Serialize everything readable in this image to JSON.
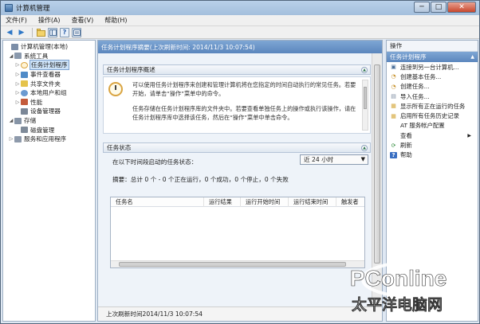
{
  "window": {
    "title": "计算机管理",
    "buttons": {
      "minimize": "─",
      "maximize": "□",
      "close": "✕"
    }
  },
  "menubar": {
    "items": [
      "文件(F)",
      "操作(A)",
      "查看(V)",
      "帮助(H)"
    ]
  },
  "toolbar": {
    "back": "◀",
    "forward": "▶"
  },
  "tree": {
    "items": [
      {
        "label": "计算机管理(本地)",
        "expander": "",
        "icon": "computer-management-icon",
        "color": "#7c8ea8"
      },
      {
        "label": "系统工具",
        "expander": "◢",
        "icon": "system-tools-icon",
        "color": "#8a99ad"
      },
      {
        "label": "任务计划程序",
        "expander": "▷",
        "icon": "clock-icon",
        "color": "#d9a441",
        "selected": true
      },
      {
        "label": "事件查看器",
        "expander": "▷",
        "icon": "event-viewer-icon",
        "color": "#4f8bc8"
      },
      {
        "label": "共享文件夹",
        "expander": "▷",
        "icon": "shared-folder-icon",
        "color": "#e5c34b"
      },
      {
        "label": "本地用户和组",
        "expander": "▷",
        "icon": "users-icon",
        "color": "#6b9ad1"
      },
      {
        "label": "性能",
        "expander": "▷",
        "icon": "performance-icon",
        "color": "#c45b3c"
      },
      {
        "label": "设备管理器",
        "expander": "",
        "icon": "device-manager-icon",
        "color": "#7b8797"
      },
      {
        "label": "存储",
        "expander": "◢",
        "icon": "storage-icon",
        "color": "#8694a6"
      },
      {
        "label": "磁盘管理",
        "expander": "",
        "icon": "disk-icon",
        "color": "#7f8b99"
      },
      {
        "label": "服务和应用程序",
        "expander": "▷",
        "icon": "services-icon",
        "color": "#8e9aab"
      }
    ]
  },
  "center": {
    "header": "任务计划程序摘要(上次刷新时间: 2014/11/3 10:07:54)",
    "overview": {
      "title": "任务计划程序概述",
      "para1_line1": "可以使用任务计划程序来创建和管理计算机将在您指定的时间自动执行的常见任务。若要",
      "para1_line2": "开始，请单击“操作”菜单中的命令。",
      "para2_line1": "任务存储在任务计划程序库的文件夹中。若要查看单独任务上的操作或执行该操作，请在",
      "para2_line2": "任务计划程序库中选择该任务，然后在“操作”菜单中单击命令。"
    },
    "status": {
      "title": "任务状态",
      "label": "在以下时间段启动的任务状态：",
      "dropdown_value": "近 24 小时",
      "summary": "摘要：总计 0 个 - 0 个正在运行，0 个成功，0 个停止，0 个失败"
    },
    "table": {
      "columns": [
        "任务名",
        "运行结果",
        "运行开始时间",
        "运行结束时间",
        "触发者"
      ]
    },
    "last_refresh": "上次刷新时间2014/11/3 10:07:54"
  },
  "actions": {
    "title": "操作",
    "section": "任务计划程序",
    "items": [
      {
        "label": "连接到另一台计算机...",
        "icon": "computer-icon",
        "glyph": "▣"
      },
      {
        "label": "创建基本任务...",
        "icon": "create-basic-task-icon",
        "glyph": "◔"
      },
      {
        "label": "创建任务...",
        "icon": "create-task-icon",
        "glyph": "◔"
      },
      {
        "label": "导入任务...",
        "icon": "import-task-icon",
        "glyph": "▤"
      },
      {
        "label": "显示所有正在运行的任务",
        "icon": "running-tasks-icon",
        "glyph": "▦"
      },
      {
        "label": "启用所有任务历史记录",
        "icon": "history-icon",
        "glyph": "▦"
      },
      {
        "label": "AT 服务帐户配置",
        "icon": "",
        "glyph": ""
      },
      {
        "label": "查看",
        "icon": "",
        "glyph": "",
        "submenu": true
      },
      {
        "label": "刷新",
        "icon": "refresh-icon",
        "glyph": "⟳"
      },
      {
        "label": "帮助",
        "icon": "help-icon",
        "glyph": "?"
      }
    ]
  },
  "watermark": {
    "brand": "PConline",
    "sub": "太平洋电脑网"
  }
}
